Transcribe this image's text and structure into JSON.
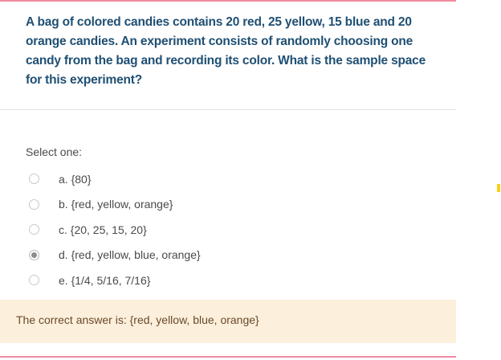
{
  "question": {
    "text": "A bag of colored candies contains 20 red, 25 yellow, 15 blue and 20 orange candies. An experiment consists of randomly choosing one candy from the bag and recording its color. What is the sample space for this experiment?"
  },
  "answer": {
    "prompt": "Select one:",
    "options": [
      {
        "label": "a. {80}",
        "selected": false
      },
      {
        "label": "b. {red, yellow, orange}",
        "selected": false
      },
      {
        "label": "c. {20, 25, 15, 20}",
        "selected": false
      },
      {
        "label": "d. {red, yellow, blue, orange}",
        "selected": true
      },
      {
        "label": "e. {1/4, 5/16, 7/16}",
        "selected": false
      }
    ]
  },
  "feedback": {
    "text": "The correct answer is: {red, yellow, blue, orange}"
  },
  "colors": {
    "accent_rule": "#f08aa0",
    "question_text": "#1f4f73",
    "feedback_background": "#fcefdc",
    "side_marker": "#f2d21a"
  }
}
